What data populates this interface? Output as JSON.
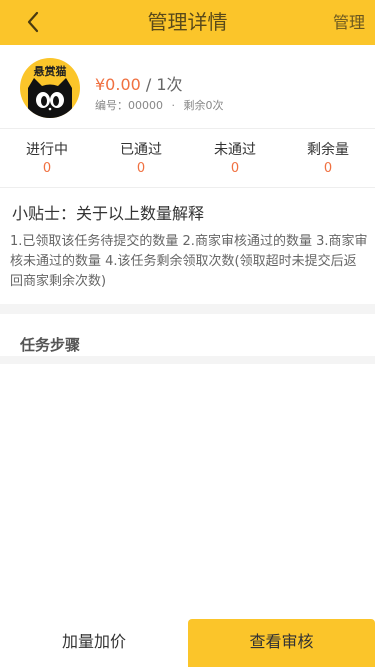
{
  "header": {
    "title": "管理详情",
    "manage_label": "管理",
    "back_icon": "chevron-left-icon"
  },
  "task": {
    "avatar_text": "悬赏猫",
    "price": "¥0.00",
    "count_text": " / 1次",
    "number_label": "编号：00000",
    "separator": "·",
    "remaining_label": "剩余0次"
  },
  "stats": [
    {
      "label": "进行中",
      "value": "0"
    },
    {
      "label": "已通过",
      "value": "0"
    },
    {
      "label": "未通过",
      "value": "0"
    },
    {
      "label": "剩余量",
      "value": "0"
    }
  ],
  "tips": {
    "title": "小贴士：关于以上数量解释",
    "body": "1.已领取该任务待提交的数量 2.商家审核通过的数量 3.商家审核未通过的数量 4.该任务剩余领取次数(领取超时未提交后返回商家剩余次数)"
  },
  "steps": {
    "title": "任务步骤"
  },
  "footer": {
    "add_label": "加量加价",
    "review_label": "查看审核"
  },
  "colors": {
    "accent": "#fbc52a",
    "price": "#f07040"
  }
}
